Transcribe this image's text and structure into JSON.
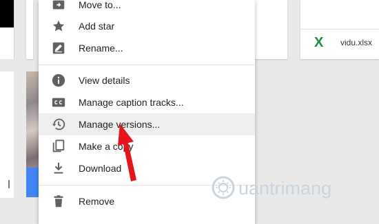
{
  "background": {
    "file_name": "vidu.xlsx",
    "excel_icon_glyph": "X",
    "colors": {
      "page": "#e9e9e9",
      "card": "#ffffff",
      "blue_bar": "#4285f4",
      "excel_green": "#1e8e3e"
    }
  },
  "menu": {
    "items": [
      {
        "label": "Move to...",
        "icon": "move-to-icon"
      },
      {
        "label": "Add star",
        "icon": "star-icon"
      },
      {
        "label": "Rename...",
        "icon": "rename-icon"
      },
      {
        "label": "View details",
        "icon": "info-icon"
      },
      {
        "label": "Manage caption tracks...",
        "icon": "closed-caption-icon"
      },
      {
        "label": "Manage versions...",
        "icon": "history-icon",
        "highlighted": true
      },
      {
        "label": "Make a copy",
        "icon": "copy-icon"
      },
      {
        "label": "Download",
        "icon": "download-icon"
      },
      {
        "label": "Remove",
        "icon": "trash-icon"
      }
    ],
    "colors": {
      "background": "#ffffff",
      "hover": "#eeeeee",
      "icon": "#616161",
      "text": "#212121"
    }
  },
  "annotation": {
    "arrow_color": "#e8141b"
  },
  "watermark": {
    "text": "Quantrimang",
    "color": "#c7d3df"
  }
}
